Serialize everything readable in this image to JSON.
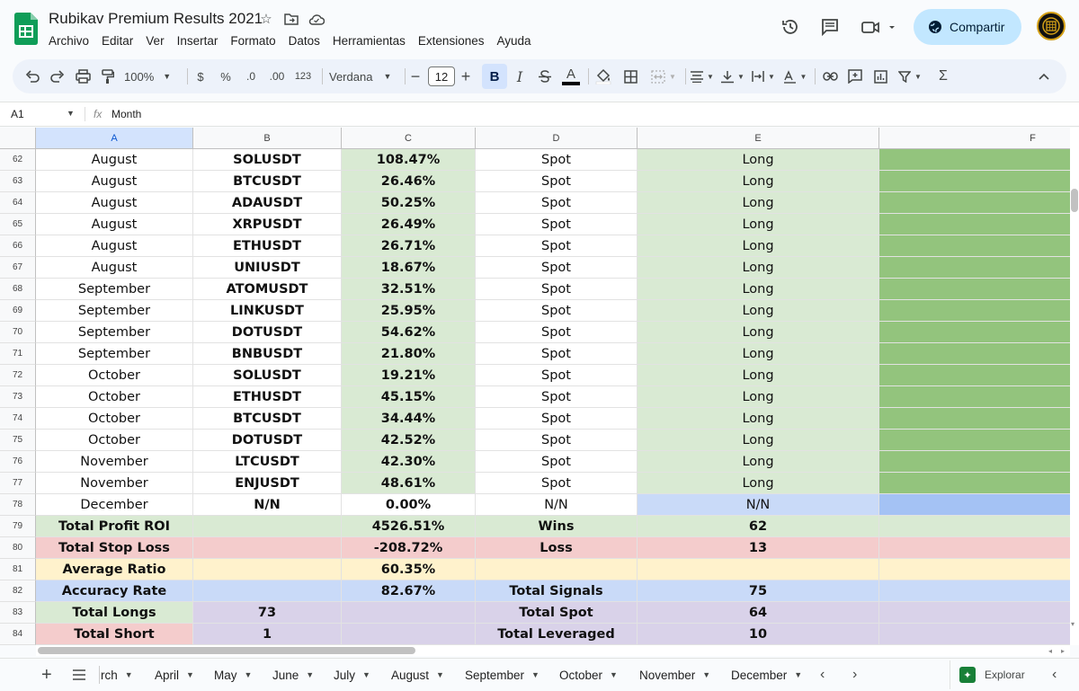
{
  "title": "Rubikav Premium Results 2021",
  "menu": [
    "Archivo",
    "Editar",
    "Ver",
    "Insertar",
    "Formato",
    "Datos",
    "Herramientas",
    "Extensiones",
    "Ayuda"
  ],
  "share_label": "Compartir",
  "toolbar": {
    "zoom": "100%",
    "currency": "$",
    "percent": "%",
    "dec_decrease": ".0",
    "dec_increase": ".00",
    "number_format": "123",
    "font": "Verdana",
    "font_size": "12",
    "bold": "B",
    "italic": "I"
  },
  "formula_bar": {
    "cell_ref": "A1",
    "fx": "fx",
    "content": "Month"
  },
  "columns": [
    "A",
    "B",
    "C",
    "D",
    "E",
    "F"
  ],
  "colors": {
    "light_green": "#d9ead3",
    "dark_green": "#93c47d",
    "light_blue": "#c9daf8",
    "mid_blue": "#a4c2f4",
    "light_red": "#f4cccc",
    "light_yellow": "#fff2cc",
    "light_purple": "#d9d2e9"
  },
  "rows": [
    {
      "n": "62",
      "a": "August",
      "b": "SOLUSDT",
      "c": "108.47%",
      "d": "Spot",
      "e": "Long"
    },
    {
      "n": "63",
      "a": "August",
      "b": "BTCUSDT",
      "c": "26.46%",
      "d": "Spot",
      "e": "Long"
    },
    {
      "n": "64",
      "a": "August",
      "b": "ADAUSDT",
      "c": "50.25%",
      "d": "Spot",
      "e": "Long"
    },
    {
      "n": "65",
      "a": "August",
      "b": "XRPUSDT",
      "c": "26.49%",
      "d": "Spot",
      "e": "Long"
    },
    {
      "n": "66",
      "a": "August",
      "b": "ETHUSDT",
      "c": "26.71%",
      "d": "Spot",
      "e": "Long"
    },
    {
      "n": "67",
      "a": "August",
      "b": "UNIUSDT",
      "c": "18.67%",
      "d": "Spot",
      "e": "Long"
    },
    {
      "n": "68",
      "a": "September",
      "b": "ATOMUSDT",
      "c": "32.51%",
      "d": "Spot",
      "e": "Long"
    },
    {
      "n": "69",
      "a": "September",
      "b": "LINKUSDT",
      "c": "25.95%",
      "d": "Spot",
      "e": "Long"
    },
    {
      "n": "70",
      "a": "September",
      "b": "DOTUSDT",
      "c": "54.62%",
      "d": "Spot",
      "e": "Long"
    },
    {
      "n": "71",
      "a": "September",
      "b": "BNBUSDT",
      "c": "21.80%",
      "d": "Spot",
      "e": "Long"
    },
    {
      "n": "72",
      "a": "October",
      "b": "SOLUSDT",
      "c": "19.21%",
      "d": "Spot",
      "e": "Long"
    },
    {
      "n": "73",
      "a": "October",
      "b": "ETHUSDT",
      "c": "45.15%",
      "d": "Spot",
      "e": "Long"
    },
    {
      "n": "74",
      "a": "October",
      "b": "BTCUSDT",
      "c": "34.44%",
      "d": "Spot",
      "e": "Long"
    },
    {
      "n": "75",
      "a": "October",
      "b": "DOTUSDT",
      "c": "42.52%",
      "d": "Spot",
      "e": "Long"
    },
    {
      "n": "76",
      "a": "November",
      "b": "LTCUSDT",
      "c": "42.30%",
      "d": "Spot",
      "e": "Long"
    },
    {
      "n": "77",
      "a": "November",
      "b": "ENJUSDT",
      "c": "48.61%",
      "d": "Spot",
      "e": "Long"
    },
    {
      "n": "78",
      "a": "December",
      "b": "N/N",
      "c": "0.00%",
      "d": "N/N",
      "e": "N/N"
    }
  ],
  "summary": [
    {
      "n": "79",
      "a": "Total Profit ROI",
      "b": "",
      "c": "4526.51%",
      "d": "Wins",
      "e": "62",
      "color": "light_green"
    },
    {
      "n": "80",
      "a": "Total Stop Loss",
      "b": "",
      "c": "-208.72%",
      "d": "Loss",
      "e": "13",
      "color": "light_red"
    },
    {
      "n": "81",
      "a": "Average Ratio",
      "b": "",
      "c": "60.35%",
      "d": "",
      "e": "",
      "color": "light_yellow"
    },
    {
      "n": "82",
      "a": "Accuracy Rate",
      "b": "",
      "c": "82.67%",
      "d": "Total Signals",
      "e": "75",
      "color": "light_blue"
    },
    {
      "n": "83",
      "a": "Total Longs",
      "b": "73",
      "c": "",
      "d": "Total Spot",
      "e": "64",
      "color": "light_purple",
      "a_color": "light_green"
    },
    {
      "n": "84",
      "a": "Total Short",
      "b": "1",
      "c": "",
      "d": "Total Leveraged",
      "e": "10",
      "color": "light_purple",
      "a_color": "light_red"
    }
  ],
  "sheet_tabs": [
    "rch",
    "April",
    "May",
    "June",
    "July",
    "August",
    "September",
    "October",
    "November",
    "December"
  ],
  "explore_label": "Explorar"
}
